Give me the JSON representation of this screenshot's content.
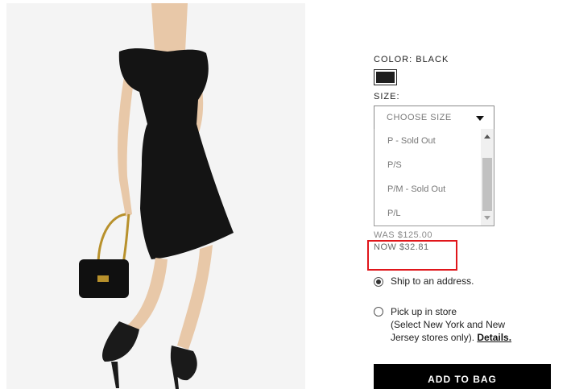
{
  "product": {
    "color_label": "COLOR: BLACK",
    "swatch_color": "#1f1f1f",
    "size_label": "SIZE:",
    "size_select": {
      "placeholder": "CHOOSE SIZE",
      "options": [
        "P - Sold Out",
        "P/S",
        "P/M - Sold Out",
        "P/L"
      ]
    },
    "price": {
      "was": "WAS $125.00",
      "now": "NOW $32.81"
    },
    "shipping": {
      "ship_label": "Ship to an address.",
      "pickup_label": "Pick up in store",
      "pickup_note_line1": "(Select New York and New",
      "pickup_note_line2_prefix": "Jersey stores only). ",
      "details_link": "Details.",
      "selected": "ship"
    },
    "add_to_bag": "ADD TO BAG",
    "highlight_color": "#e0161b"
  }
}
